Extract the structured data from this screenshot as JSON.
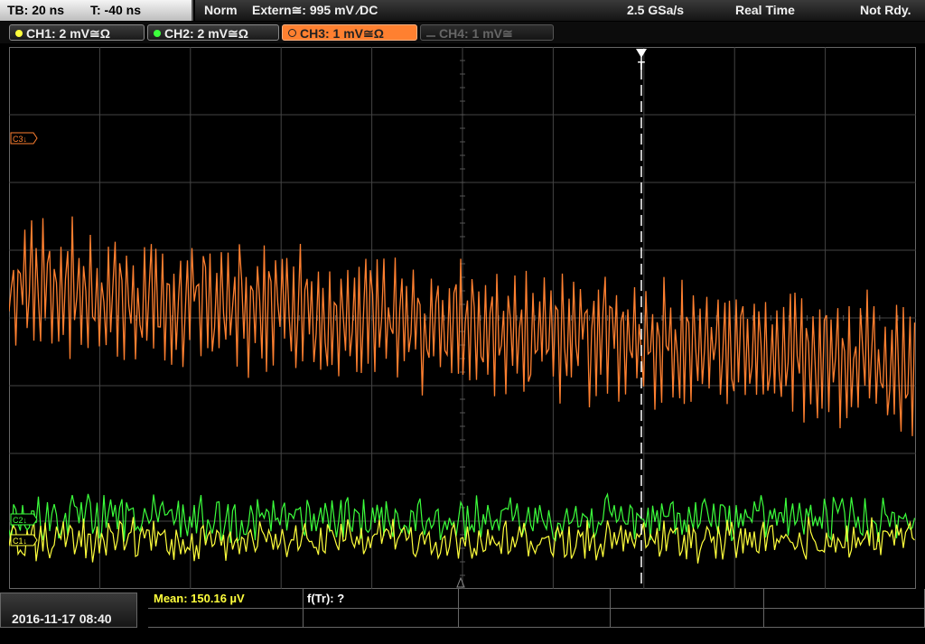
{
  "topbar": {
    "timebase": "TB: 20 ns",
    "trigger_time": "T: -40 ns",
    "mode": "Norm",
    "trigger_source": "Extern≅: 995 mV ⁄DC",
    "sample_rate": "2.5 GSa/s",
    "acq_mode": "Real Time",
    "state": "Not Rdy."
  },
  "channels": [
    {
      "label": "CH1: 2 mV≅Ω",
      "color": "#ffff3c",
      "active": true
    },
    {
      "label": "CH2: 2 mV≅Ω",
      "color": "#3cff3c",
      "active": true
    },
    {
      "label": "CH3: 1 mV≅Ω",
      "color": "#ff8030",
      "active": true,
      "selected": true
    },
    {
      "label": "CH4: 1 mV≅",
      "color": "#555555",
      "active": false
    }
  ],
  "markers": {
    "c3": "C3↓",
    "c2": "C2↓",
    "c1": "C1↓",
    "trigger": "T"
  },
  "footer": {
    "datetime": "2016-11-17 08:40",
    "mean": "Mean: 150.16 µV",
    "ftr": "f(Tr): ?"
  },
  "colors": {
    "ch1": "#ffff3c",
    "ch2": "#3cff3c",
    "ch3": "#ff8030",
    "grid": "#444444"
  }
}
